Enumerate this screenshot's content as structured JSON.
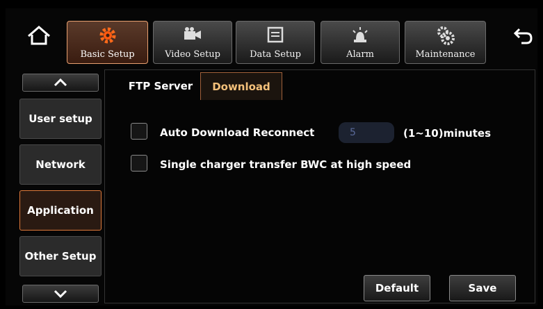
{
  "top_nav": {
    "tabs": [
      {
        "label": "Basic Setup",
        "icon": "gear-icon",
        "active": true
      },
      {
        "label": "Video Setup",
        "icon": "video-camera-icon",
        "active": false
      },
      {
        "label": "Data Setup",
        "icon": "data-storage-icon",
        "active": false
      },
      {
        "label": "Alarm",
        "icon": "alarm-light-icon",
        "active": false
      },
      {
        "label": "Maintenance",
        "icon": "maintenance-gears-icon",
        "active": false
      }
    ],
    "home_icon": "home-icon",
    "back_icon": "back-arrow-icon"
  },
  "sidebar": {
    "items": [
      {
        "label": "User setup",
        "active": false
      },
      {
        "label": "Network",
        "active": false
      },
      {
        "label": "Application",
        "active": true
      },
      {
        "label": "Other Setup",
        "active": false
      }
    ]
  },
  "subtabs": [
    {
      "label": "FTP Server",
      "active": false
    },
    {
      "label": "Download",
      "active": true
    }
  ],
  "options": {
    "auto_download": {
      "label": "Auto Download Reconnect",
      "value": "5",
      "unit": "(1~10)minutes",
      "checked": false
    },
    "single_charger": {
      "label": "Single charger transfer BWC at high speed",
      "checked": false
    }
  },
  "buttons": {
    "default": "Default",
    "save": "Save"
  },
  "colors": {
    "accent": "#e07a3a",
    "active_tab_text": "#f3c07a"
  }
}
